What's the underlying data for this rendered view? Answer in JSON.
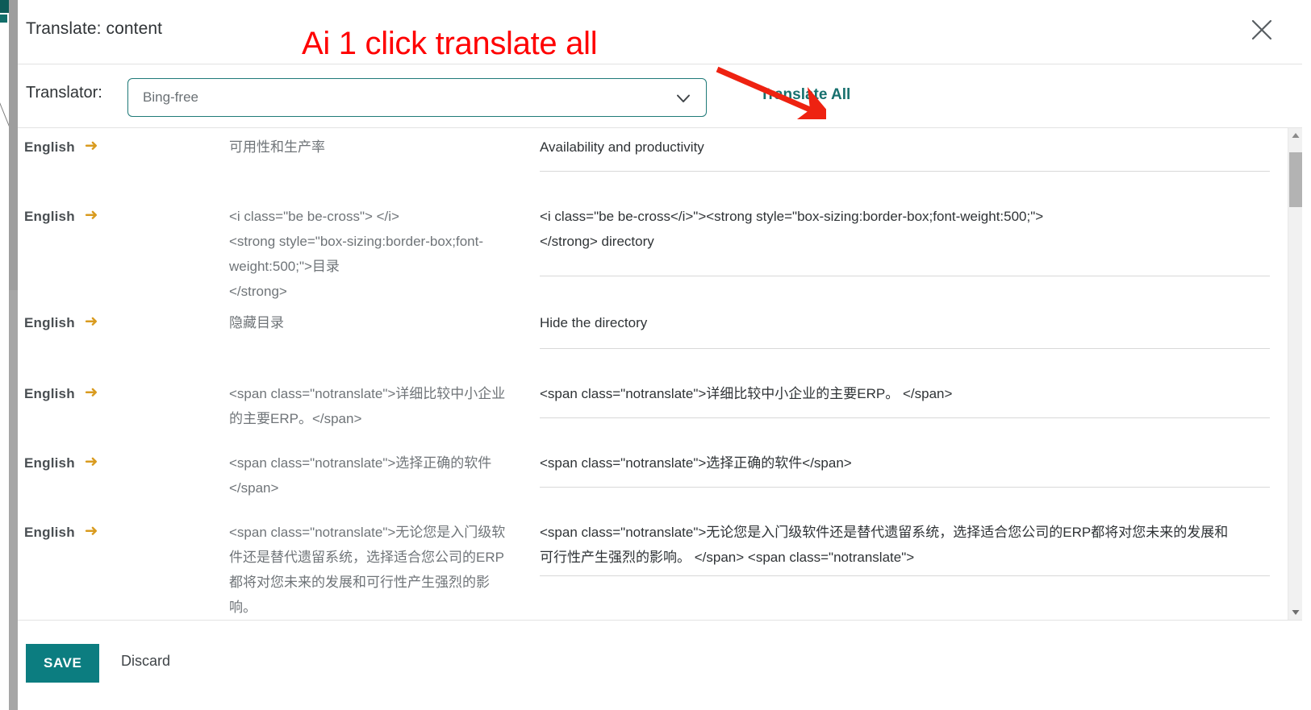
{
  "modal": {
    "title": "Translate: content",
    "close_icon": "close-icon"
  },
  "annotation": {
    "text": "Ai 1 click translate all",
    "color": "#ff0000",
    "arrow_icon": "red-arrow-icon"
  },
  "translator": {
    "label": "Translator:",
    "selected": "Bing-free",
    "placeholder": "Bing-free",
    "chevron_icon": "chevron-down-icon",
    "translate_all_label": "Translate All",
    "accent_color": "#17706e"
  },
  "rows": [
    {
      "lang": "English",
      "arrow_icon": "arrow-right-icon",
      "source": "可用性和生产率",
      "target": "Availability and productivity",
      "has_scroll": false
    },
    {
      "lang": "English",
      "arrow_icon": "arrow-right-icon",
      "source": "<i class=\"be be-cross\"> </i>\n<strong style=\"box-sizing:border-box;font-weight:500;\">目录\n</strong>",
      "target": "<i class=\"be be-cross</i>\"><strong style=\"box-sizing:border-box;font-weight:500;\">\n</strong> directory",
      "has_scroll": false
    },
    {
      "lang": "English",
      "arrow_icon": "arrow-right-icon",
      "source": "隐藏目录",
      "target": "Hide the directory",
      "has_scroll": false
    },
    {
      "lang": "English",
      "arrow_icon": "arrow-right-icon",
      "source": "<span class=\"notranslate\">详细比较中小企业的主要ERP。</span>",
      "target": "<span class=\"notranslate\">详细比较中小企业的主要ERP。 </span>",
      "has_scroll": false
    },
    {
      "lang": "English",
      "arrow_icon": "arrow-right-icon",
      "source": "<span class=\"notranslate\">选择正确的软件</span>",
      "target": "<span class=\"notranslate\">选择正确的软件</span>",
      "has_scroll": false
    },
    {
      "lang": "English",
      "arrow_icon": "arrow-right-icon",
      "source": "<span class=\"notranslate\">无论您是入门级软件还是替代遗留系统，选择适合您公司的ERP都将对您未来的发展和可行性产生强烈的影响。",
      "target": "<span class=\"notranslate\">无论您是入门级软件还是替代遗留系统，选择适合您公司的ERP都将对您未来的发展和可行性产生强烈的影响。 </span> <span class=\"notranslate\">",
      "has_scroll": true
    }
  ],
  "footer": {
    "save_label": "SAVE",
    "discard_label": "Discard",
    "save_color": "#0c7d80"
  },
  "scrollbar": {
    "up_icon": "scroll-up-icon",
    "down_icon": "scroll-down-icon"
  }
}
